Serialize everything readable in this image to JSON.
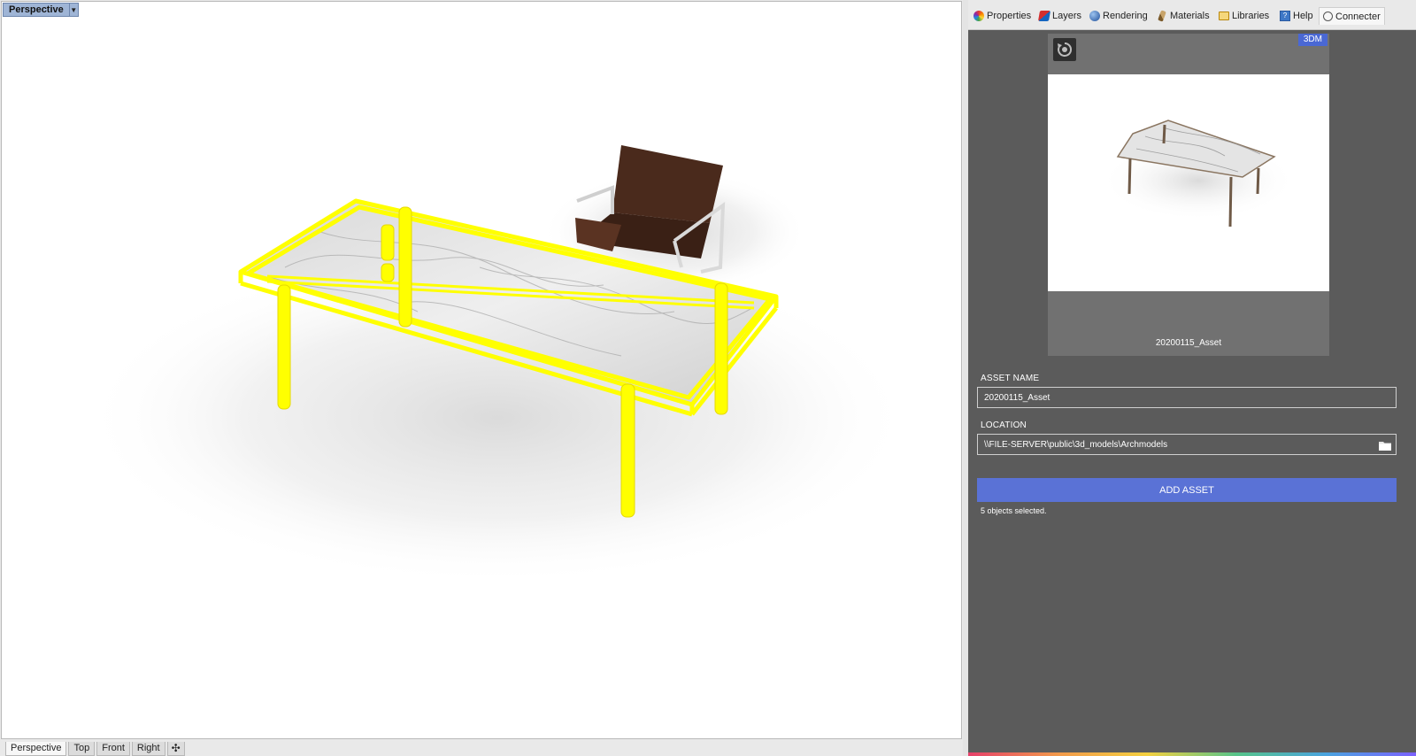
{
  "viewport": {
    "title": "Perspective",
    "dropdown_icon": "caret-down-icon"
  },
  "view_tabs": [
    {
      "label": "Perspective",
      "active": true
    },
    {
      "label": "Top",
      "active": false
    },
    {
      "label": "Front",
      "active": false
    },
    {
      "label": "Right",
      "active": false
    }
  ],
  "add_tab_icon": "plus-icon",
  "panel": {
    "tabs": [
      {
        "label": "Properties",
        "icon": "properties-icon"
      },
      {
        "label": "Layers",
        "icon": "layers-icon"
      },
      {
        "label": "Rendering",
        "icon": "rendering-icon"
      },
      {
        "label": "Materials",
        "icon": "materials-icon"
      },
      {
        "label": "Libraries",
        "icon": "libraries-icon"
      },
      {
        "label": "Help",
        "icon": "help-icon"
      },
      {
        "label": "Connecter",
        "icon": "connecter-icon",
        "active": true
      }
    ],
    "preview": {
      "badge": "3DM",
      "caption": "20200115_Asset",
      "reset_icon": "reset-icon"
    },
    "form": {
      "asset_name_label": "ASSET NAME",
      "asset_name_value": "20200115_Asset",
      "location_label": "LOCATION",
      "location_value": "\\\\FILE-SERVER\\public\\3d_models\\Archmodels",
      "folder_icon": "folder-icon",
      "add_button": "ADD ASSET",
      "status": "5 objects selected."
    }
  },
  "colors": {
    "selection": "#ffff00",
    "panel_bg": "#5b5b5b",
    "accent": "#5a72d6"
  }
}
